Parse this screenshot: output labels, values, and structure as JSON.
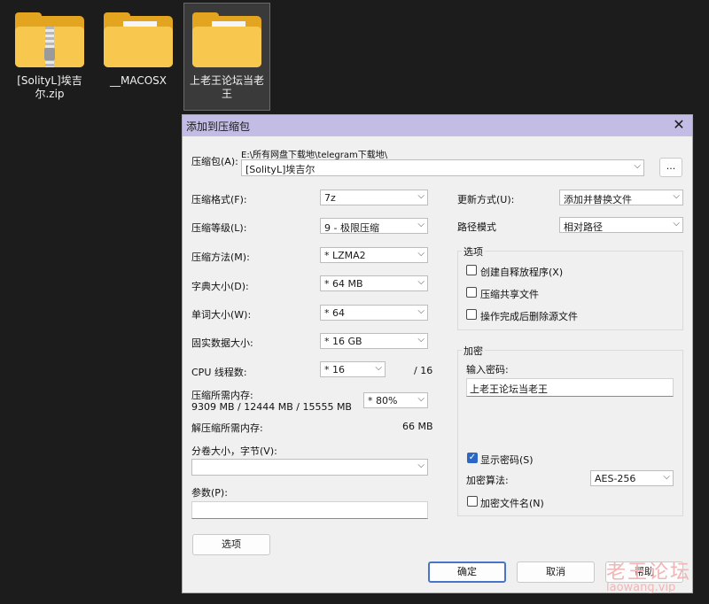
{
  "desktop": {
    "items": [
      {
        "label": "[SolityL]埃吉尔.zip",
        "icon": "zip-folder-icon"
      },
      {
        "label": "__MACOSX",
        "icon": "folder-icon"
      },
      {
        "label": "上老王论坛当老王",
        "icon": "folder-icon"
      }
    ]
  },
  "dialog": {
    "title": "添加到压缩包",
    "close_glyph": "✕",
    "archive_label": "压缩包(A):",
    "archive_path": "E:\\所有网盘下载地\\telegram下载地\\",
    "archive_name": "[SolityL]埃吉尔",
    "browse_label": "...",
    "format_label": "压缩格式(F):",
    "format_value": "7z",
    "level_label": "压缩等级(L):",
    "level_value": "9 - 极限压缩",
    "method_label": "压缩方法(M):",
    "method_value": "*  LZMA2",
    "dict_label": "字典大小(D):",
    "dict_value": "*  64 MB",
    "word_label": "单词大小(W):",
    "word_value": "*  64",
    "solid_label": "固实数据大小:",
    "solid_value": "*  16 GB",
    "cpu_label": "CPU 线程数:",
    "cpu_value": "*  16",
    "cpu_total": "/ 16",
    "mem_label": "压缩所需内存:",
    "mem_values": "9309 MB / 12444 MB / 15555 MB",
    "mem_percent": "*  80%",
    "decomp_label": "解压缩所需内存:",
    "decomp_value": "66 MB",
    "volume_label": "分卷大小，字节(V):",
    "volume_value": "",
    "params_label": "参数(P):",
    "params_value": "",
    "options_button": "选项",
    "update_label": "更新方式(U):",
    "update_value": "添加并替换文件",
    "path_label": "路径模式",
    "path_value": "相对路径",
    "options_group": "选项",
    "opt_sfx": "创建自释放程序(X)",
    "opt_shared": "压缩共享文件",
    "opt_delete": "操作完成后删除源文件",
    "encrypt_group": "加密",
    "password_label": "输入密码:",
    "password_value": "上老王论坛当老王",
    "show_password": "显示密码(S)",
    "enc_method_label": "加密算法:",
    "enc_method_value": "AES-256",
    "encrypt_names": "加密文件名(N)",
    "ok_button": "确定",
    "cancel_button": "取消",
    "help_button": "帮助"
  },
  "watermark": {
    "line1": "老王论坛",
    "line2": "laowang.vip"
  }
}
